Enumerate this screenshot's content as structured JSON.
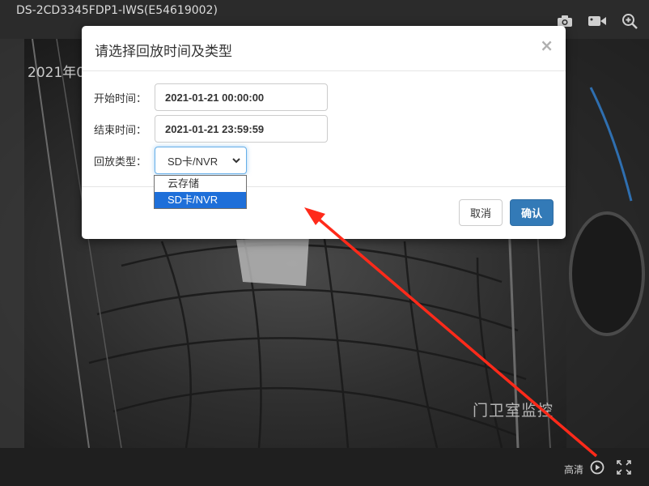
{
  "window": {
    "device_title": "DS-2CD3345FDP1-IWS(E54619002)"
  },
  "toolbar_icons": [
    "camera-icon",
    "video-record-icon",
    "zoom-in-icon"
  ],
  "video": {
    "osd_time": "2021年0",
    "osd_label": "门卫室监控"
  },
  "modal": {
    "title": "请选择回放时间及类型",
    "close_label": "×",
    "start_label": "开始时间：",
    "start_value": "2021-01-21 00:00:00",
    "end_label": "结束时间：",
    "end_value": "2021-01-21 23:59:59",
    "type_label": "回放类型：",
    "type_selected": "SD卡/NVR",
    "type_options": [
      "云存储",
      "SD卡/NVR"
    ],
    "cancel_label": "取消",
    "ok_label": "确认"
  },
  "bottom": {
    "quality_label": "高清"
  },
  "colors": {
    "primary": "#337ab7",
    "selected_option": "#1e6fd9",
    "annotation_arrow": "#ff2a1a"
  }
}
